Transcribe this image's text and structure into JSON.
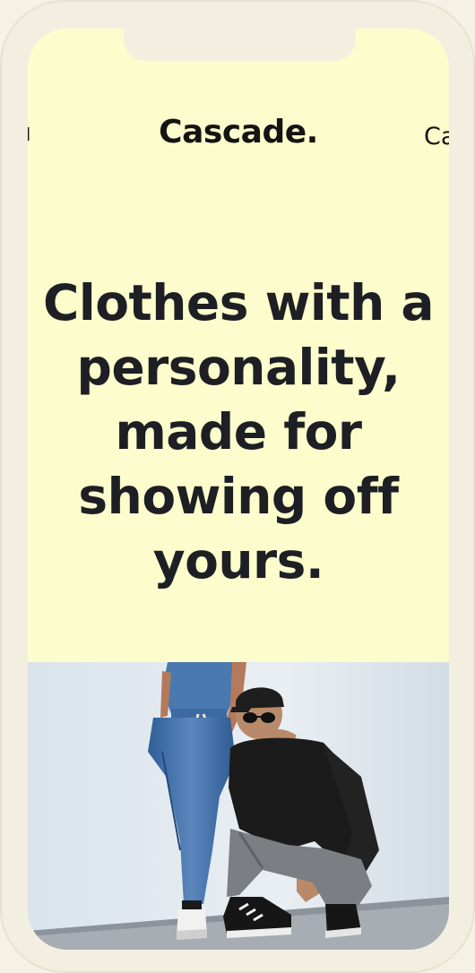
{
  "header": {
    "brand": "Cascade.",
    "prev_brand_fragment": "ı",
    "next_brand_fragment": "Ca"
  },
  "hero": {
    "line1": "Clothes with a",
    "line2": "personality,",
    "line3": "made for",
    "line4": "showing off",
    "line5": "yours."
  },
  "photo": {
    "icon": "two-people-fashion-photo"
  },
  "colors": {
    "background": "#fdfccc",
    "frame": "#f3efe0",
    "text": "#1d1f24"
  }
}
